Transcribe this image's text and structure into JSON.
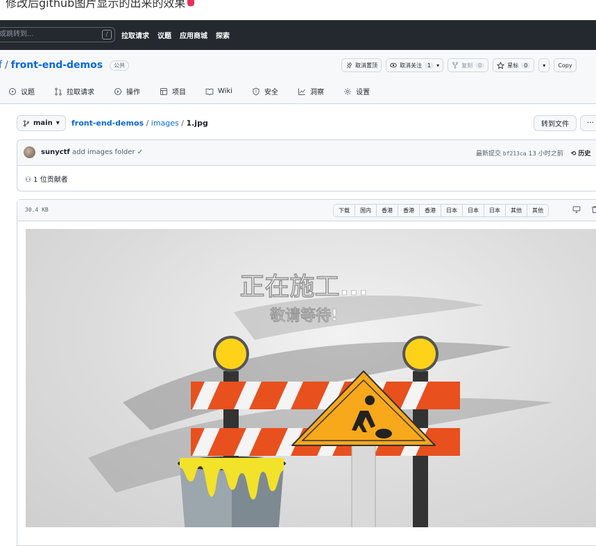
{
  "caption": {
    "text": "修改后github图片显示的出来的效果"
  },
  "topbar": {
    "search_placeholder": "或跳转到...",
    "search_key": "/",
    "nav": [
      "拉取请求",
      "议题",
      "应用商城",
      "探索"
    ]
  },
  "repo": {
    "owner": "f",
    "name": "front-end-demos",
    "visibility": "公共",
    "actions": [
      {
        "label": "取消置顶",
        "icon": "pin-slash-icon"
      },
      {
        "label": "取消关注",
        "count": "1",
        "icon": "eye-icon"
      },
      {
        "label": "复刻",
        "count": "0",
        "icon": "fork-icon"
      },
      {
        "label": "星标",
        "count": "0",
        "icon": "star-icon"
      },
      {
        "label": "Copy"
      }
    ],
    "tabs": [
      {
        "label": "议题",
        "icon": "issue-icon"
      },
      {
        "label": "拉取请求",
        "icon": "pull-request-icon"
      },
      {
        "label": "操作",
        "icon": "actions-icon"
      },
      {
        "label": "项目",
        "icon": "project-icon"
      },
      {
        "label": "Wiki",
        "icon": "book-icon"
      },
      {
        "label": "安全",
        "icon": "shield-icon"
      },
      {
        "label": "洞察",
        "icon": "graph-icon"
      },
      {
        "label": "设置",
        "icon": "gear-icon"
      }
    ]
  },
  "file": {
    "branch": "main",
    "path_root": "front-end-demos",
    "path_dir": "images",
    "path_file": "1.jpg",
    "goto_file": "转到文件",
    "more": "···",
    "commit": {
      "user": "sunyctf",
      "message": "add images folder",
      "check": "✓",
      "latest_label": "最新提交",
      "sha": "bf213ca",
      "time": "13 小时之前",
      "history": "历史"
    },
    "contributors": "1 位贡献者",
    "size": "30.4 KB",
    "view_buttons": [
      "下载",
      "国内",
      "香港",
      "香港",
      "香港",
      "日本",
      "日本",
      "日本",
      "其他",
      "其他"
    ]
  },
  "image": {
    "title": "正在施工...",
    "subtitle": "敬请等待!",
    "colors": {
      "stripe": "#e8501e",
      "sign": "#f7a81b",
      "lamp": "#ffd21a"
    }
  }
}
